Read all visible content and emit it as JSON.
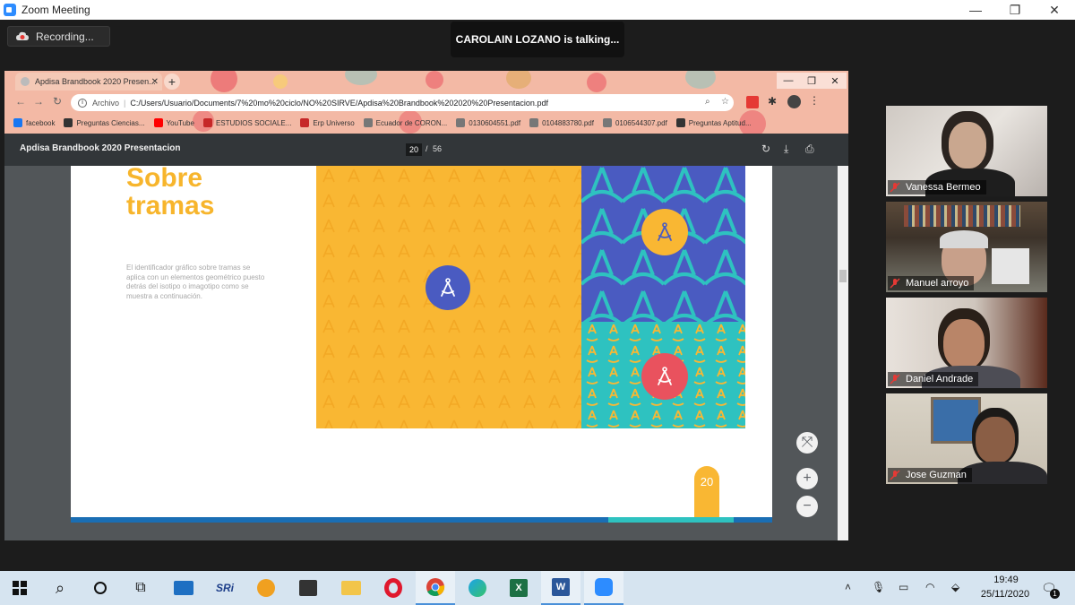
{
  "window": {
    "title": "Zoom Meeting",
    "minimize": "—",
    "maximize": "❐",
    "close": "✕"
  },
  "meeting": {
    "recording_label": "Recording...",
    "talking_notice": "CAROLAIN LOZANO is talking..."
  },
  "browser": {
    "tab_title": "Apdisa Brandbook 2020 Presen...",
    "tab_close": "✕",
    "new_tab": "+",
    "omnibox_scheme": "Archivo",
    "omnibox_sep": "|",
    "omnibox_url": "C:/Users/Usuario/Documents/7%20mo%20ciclo/NO%20SIRVE/Apdisa%20Brandbook%202020%20Presentacion.pdf",
    "bookmarks": [
      {
        "label": "facebook",
        "color": "#1877f2"
      },
      {
        "label": "Preguntas Ciencias...",
        "color": "#333333"
      },
      {
        "label": "YouTube",
        "color": "#ff0000"
      },
      {
        "label": "ESTUDIOS SOCIALE...",
        "color": "#c62828"
      },
      {
        "label": "Erp Universo",
        "color": "#c62828"
      },
      {
        "label": "Ecuador de CORON...",
        "color": "#777777"
      },
      {
        "label": "0130604551.pdf",
        "color": "#777777"
      },
      {
        "label": "0104883780.pdf",
        "color": "#777777"
      },
      {
        "label": "0106544307.pdf",
        "color": "#777777"
      },
      {
        "label": "Preguntas Aptitud...",
        "color": "#333333"
      }
    ]
  },
  "pdf": {
    "title": "Apdisa Brandbook 2020 Presentacion",
    "current_page": "20",
    "page_sep": "/",
    "total_pages": "56",
    "heading_line1": "Sobre",
    "heading_line2": "tramas",
    "body_text": "El identificador gráfico sobre tramas se aplica con un elementos geométrico puesto detrás del isotipo o imagotipo como se muestra a continuación.",
    "page_tab_number": "20",
    "zoom_fit": "⤧",
    "zoom_in": "+",
    "zoom_out": "−"
  },
  "participants": [
    {
      "name": "Vanessa Bermeo"
    },
    {
      "name": "Manuel arroyo"
    },
    {
      "name": "Daniel Andrade"
    },
    {
      "name": "Jose Guzman"
    }
  ],
  "taskbar": {
    "time": "19:49",
    "date": "25/11/2020",
    "notification_count": "1"
  },
  "colors": {
    "zoom_blue": "#2d8cff",
    "brand_yellow": "#f9b733",
    "brand_blue": "#4a5bc1",
    "brand_teal": "#2ec2c0",
    "brand_red": "#e9525e",
    "muted_mic": "#e53935"
  }
}
